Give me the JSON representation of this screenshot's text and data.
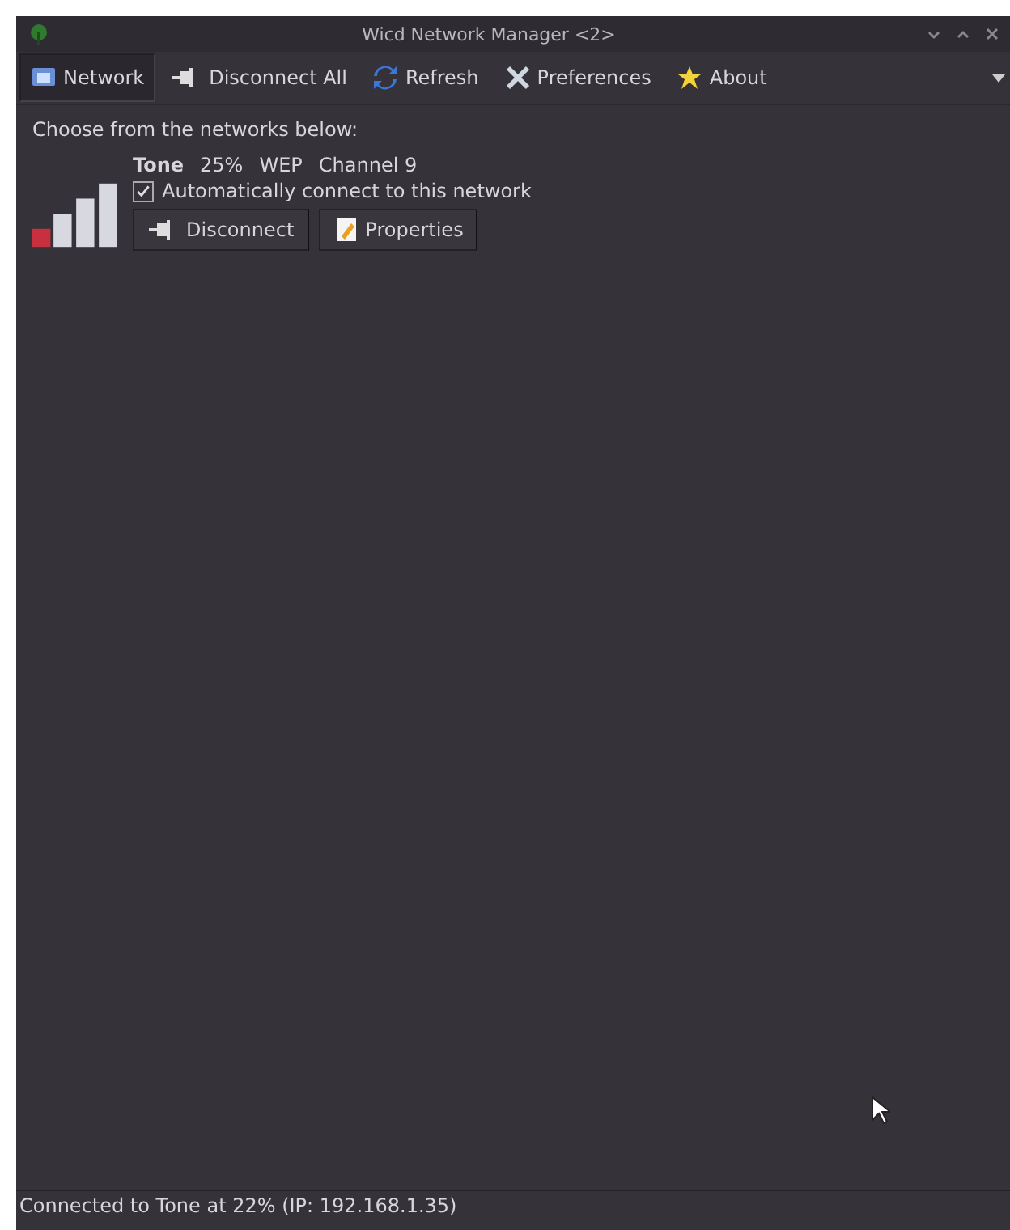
{
  "window": {
    "title": "Wicd Network Manager <2>"
  },
  "toolbar": [
    {
      "label": "Network",
      "kind": "network",
      "selected": true
    },
    {
      "label": "Disconnect All",
      "kind": "disconnect",
      "selected": false
    },
    {
      "label": "Refresh",
      "kind": "refresh",
      "selected": false
    },
    {
      "label": "Preferences",
      "kind": "preferences",
      "selected": false
    },
    {
      "label": "About",
      "kind": "about",
      "selected": false
    }
  ],
  "prompt": "Choose from the networks below:",
  "networks": [
    {
      "name": "Tone",
      "strength": "25%",
      "encryption": "WEP",
      "channel": "Channel 9",
      "auto_connect": {
        "label": "Automatically connect to this network",
        "checked": true
      },
      "buttons": [
        {
          "label": "Disconnect",
          "kind": "disconnect"
        },
        {
          "label": "Properties",
          "kind": "properties"
        }
      ]
    }
  ],
  "status_bar": "Connected to Tone at 22% (IP: 192.168.1.35)"
}
